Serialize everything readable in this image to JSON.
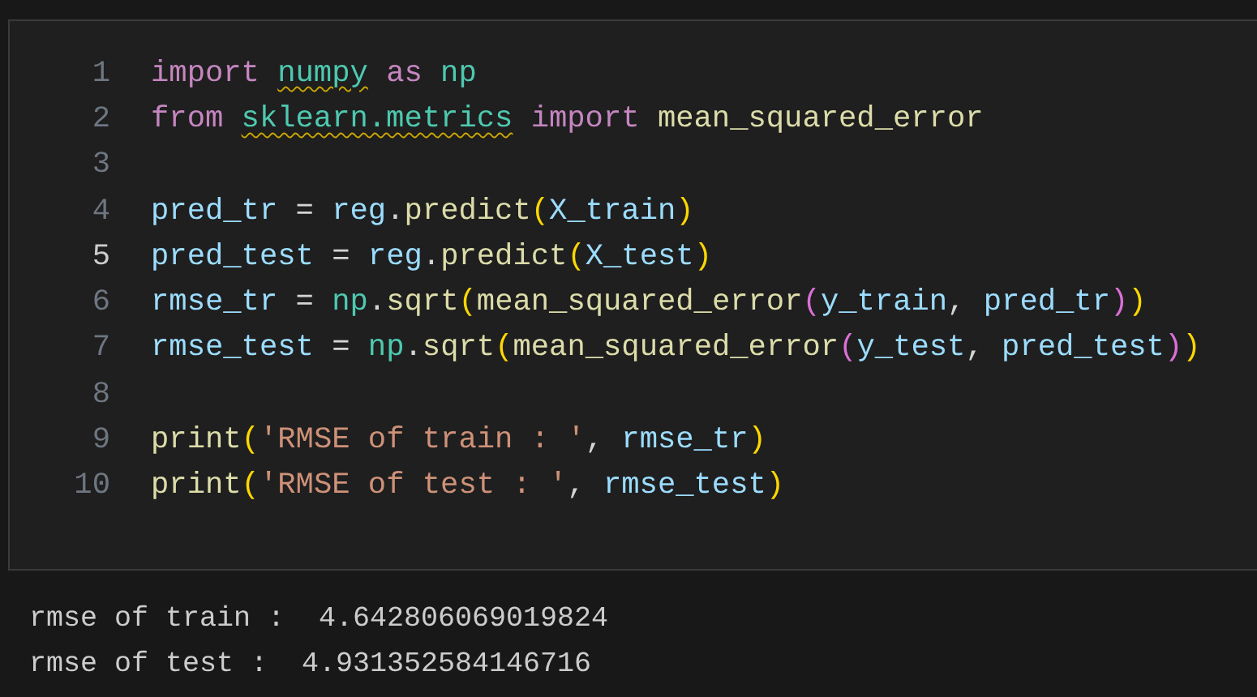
{
  "cell": {
    "lines": [
      {
        "number": "1",
        "active": false,
        "tokens": [
          {
            "text": "import ",
            "kind": "keyword",
            "warning": false
          },
          {
            "text": "numpy",
            "kind": "module",
            "warning": true
          },
          {
            "text": " as ",
            "kind": "keyword",
            "warning": false
          },
          {
            "text": "np",
            "kind": "module",
            "warning": false
          }
        ]
      },
      {
        "number": "2",
        "active": false,
        "tokens": [
          {
            "text": "from ",
            "kind": "keyword",
            "warning": false
          },
          {
            "text": "sklearn.metrics",
            "kind": "module",
            "warning": true
          },
          {
            "text": " import ",
            "kind": "keyword",
            "warning": false
          },
          {
            "text": "mean_squared_error",
            "kind": "function",
            "warning": false
          }
        ]
      },
      {
        "number": "3",
        "active": false
      },
      {
        "number": "4",
        "active": false,
        "tokens": [
          {
            "text": "pred_tr",
            "kind": "variable"
          },
          {
            "text": " = ",
            "kind": "plain"
          },
          {
            "text": "reg",
            "kind": "variable"
          },
          {
            "text": ".",
            "kind": "plain"
          },
          {
            "text": "predict",
            "kind": "function"
          },
          {
            "text": "(",
            "kind": "bracket1"
          },
          {
            "text": "X_train",
            "kind": "variable"
          },
          {
            "text": ")",
            "kind": "bracket1"
          }
        ]
      },
      {
        "number": "5",
        "active": true,
        "tokens": [
          {
            "text": "pred_test",
            "kind": "variable"
          },
          {
            "text": " = ",
            "kind": "plain"
          },
          {
            "text": "reg",
            "kind": "variable"
          },
          {
            "text": ".",
            "kind": "plain"
          },
          {
            "text": "predict",
            "kind": "function"
          },
          {
            "text": "(",
            "kind": "bracket1"
          },
          {
            "text": "X_test",
            "kind": "variable"
          },
          {
            "text": ")",
            "kind": "bracket1"
          }
        ]
      },
      {
        "number": "6",
        "active": false,
        "tokens": [
          {
            "text": "rmse_tr",
            "kind": "variable"
          },
          {
            "text": " = ",
            "kind": "plain"
          },
          {
            "text": "np",
            "kind": "module"
          },
          {
            "text": ".",
            "kind": "plain"
          },
          {
            "text": "sqrt",
            "kind": "function"
          },
          {
            "text": "(",
            "kind": "bracket1"
          },
          {
            "text": "mean_squared_error",
            "kind": "function"
          },
          {
            "text": "(",
            "kind": "bracket2"
          },
          {
            "text": "y_train",
            "kind": "variable"
          },
          {
            "text": ", ",
            "kind": "plain"
          },
          {
            "text": "pred_tr",
            "kind": "variable"
          },
          {
            "text": ")",
            "kind": "bracket2"
          },
          {
            "text": ")",
            "kind": "bracket1"
          }
        ]
      },
      {
        "number": "7",
        "active": false,
        "tokens": [
          {
            "text": "rmse_test",
            "kind": "variable"
          },
          {
            "text": " = ",
            "kind": "plain"
          },
          {
            "text": "np",
            "kind": "module"
          },
          {
            "text": ".",
            "kind": "plain"
          },
          {
            "text": "sqrt",
            "kind": "function"
          },
          {
            "text": "(",
            "kind": "bracket1"
          },
          {
            "text": "mean_squared_error",
            "kind": "function"
          },
          {
            "text": "(",
            "kind": "bracket2"
          },
          {
            "text": "y_test",
            "kind": "variable"
          },
          {
            "text": ", ",
            "kind": "plain"
          },
          {
            "text": "pred_test",
            "kind": "variable"
          },
          {
            "text": ")",
            "kind": "bracket2"
          },
          {
            "text": ")",
            "kind": "bracket1"
          }
        ]
      },
      {
        "number": "8",
        "active": false
      },
      {
        "number": "9",
        "active": false,
        "tokens": [
          {
            "text": "print",
            "kind": "function"
          },
          {
            "text": "(",
            "kind": "bracket1"
          },
          {
            "text": "'RMSE of train : '",
            "kind": "string"
          },
          {
            "text": ", ",
            "kind": "plain"
          },
          {
            "text": "rmse_tr",
            "kind": "variable"
          },
          {
            "text": ")",
            "kind": "bracket1"
          }
        ]
      },
      {
        "number": "10",
        "active": false,
        "tokens": [
          {
            "text": "print",
            "kind": "function"
          },
          {
            "text": "(",
            "kind": "bracket1"
          },
          {
            "text": "'RMSE of test : '",
            "kind": "string"
          },
          {
            "text": ", ",
            "kind": "plain"
          },
          {
            "text": "rmse_test",
            "kind": "variable"
          },
          {
            "text": ")",
            "kind": "bracket1"
          }
        ]
      }
    ]
  },
  "output": [
    "rmse of train :  4.642806069019824",
    "rmse of test :  4.931352584146716"
  ]
}
